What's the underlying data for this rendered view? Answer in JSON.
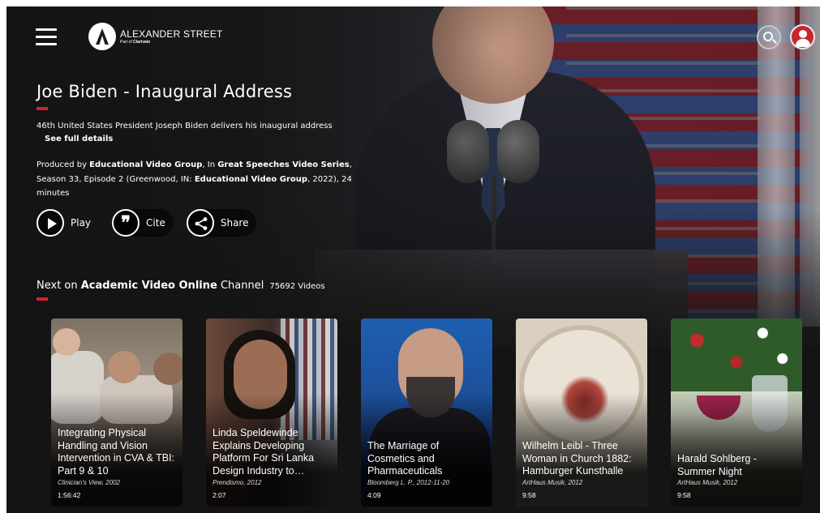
{
  "header": {
    "logo": {
      "name": "ALEXANDER STREET",
      "sub_prefix": "Part of ",
      "sub_brand": "Clarivate"
    },
    "icons": {
      "menu": "hamburger-menu-icon",
      "search": "search-icon",
      "user": "user-avatar-icon"
    }
  },
  "video": {
    "title": "Joe Biden - Inaugural Address",
    "description": "46th United States President Joseph Biden delivers his inaugural address",
    "see_full_details": "See full details",
    "produced": {
      "p1": "Produced by ",
      "producer": "Educational Video Group",
      "p2": ", In ",
      "series": "Great Speeches Video Series",
      "p3": ", Season 33, Episode 2 (Greenwood, IN: ",
      "publisher": "Educational Video Group",
      "p4": ", 2022), 24 minutes"
    },
    "actions": {
      "play": "Play",
      "cite": "Cite",
      "share": "Share"
    }
  },
  "channel": {
    "prefix": "Next on ",
    "name": "Academic Video Online",
    "suffix": " Channel",
    "count": "75692 Videos",
    "cards": [
      {
        "title": "Integrating Physical Handling and Vision Intervention in CVA & TBI: Part 9 & 10",
        "meta": "Clinician's View, 2002",
        "duration": "1:56:42"
      },
      {
        "title": "Linda Speldewinde Explains Developing Platform For Sri Lanka Design Industry to…",
        "meta": "Prendismo, 2012",
        "duration": "2:07"
      },
      {
        "title": "The Marriage of Cosmetics and Pharmaceuticals",
        "meta": "Bloomberg L. P., 2012-11-20",
        "duration": "4:09"
      },
      {
        "title": "Wilhelm Leibl - Three Woman in Church 1882: Hamburger Kunsthalle",
        "meta": "ArtHaus Musik, 2012",
        "duration": "9:58"
      },
      {
        "title": "Harald Sohlberg - Summer Night",
        "meta": "ArtHaus Musik, 2012",
        "duration": "9:58"
      }
    ]
  },
  "colors": {
    "accent": "#c8262c",
    "background": "#141414"
  }
}
